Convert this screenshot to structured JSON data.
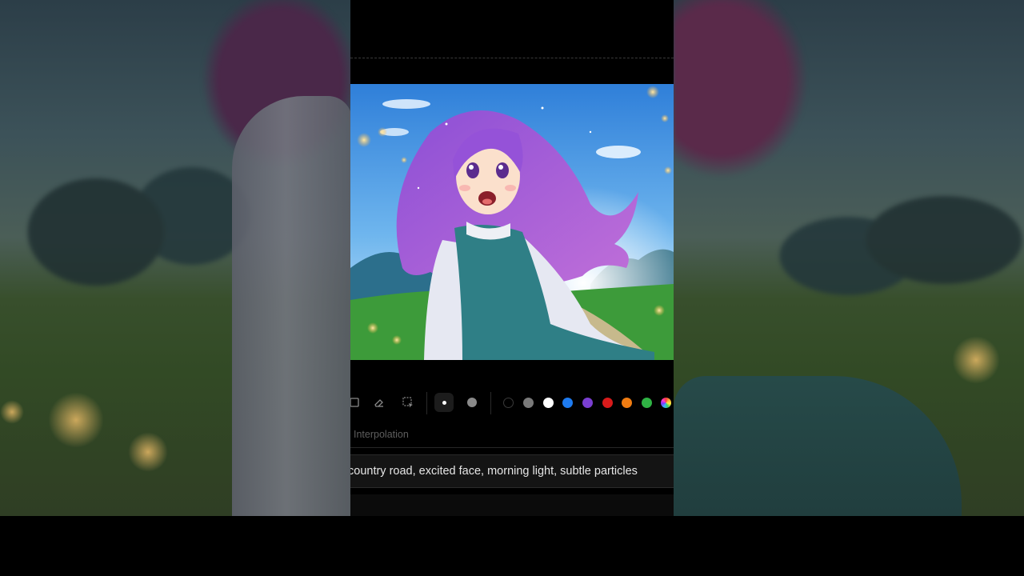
{
  "toolbar": {
    "tools": [
      "rectangle-icon",
      "eraser-icon",
      "selection-icon"
    ],
    "brush_sizes": [
      "small",
      "large"
    ],
    "selected_brush": "small",
    "colors": [
      "#000000",
      "#7a7a7a",
      "#ffffff",
      "#1e7bf0",
      "#7a3fd1",
      "#d81b1b",
      "#f07c12",
      "#2fb344",
      "rainbow"
    ]
  },
  "interpolation": {
    "label": "Interpolation"
  },
  "prompt": {
    "text": "country road, excited face, morning light, subtle particles"
  }
}
